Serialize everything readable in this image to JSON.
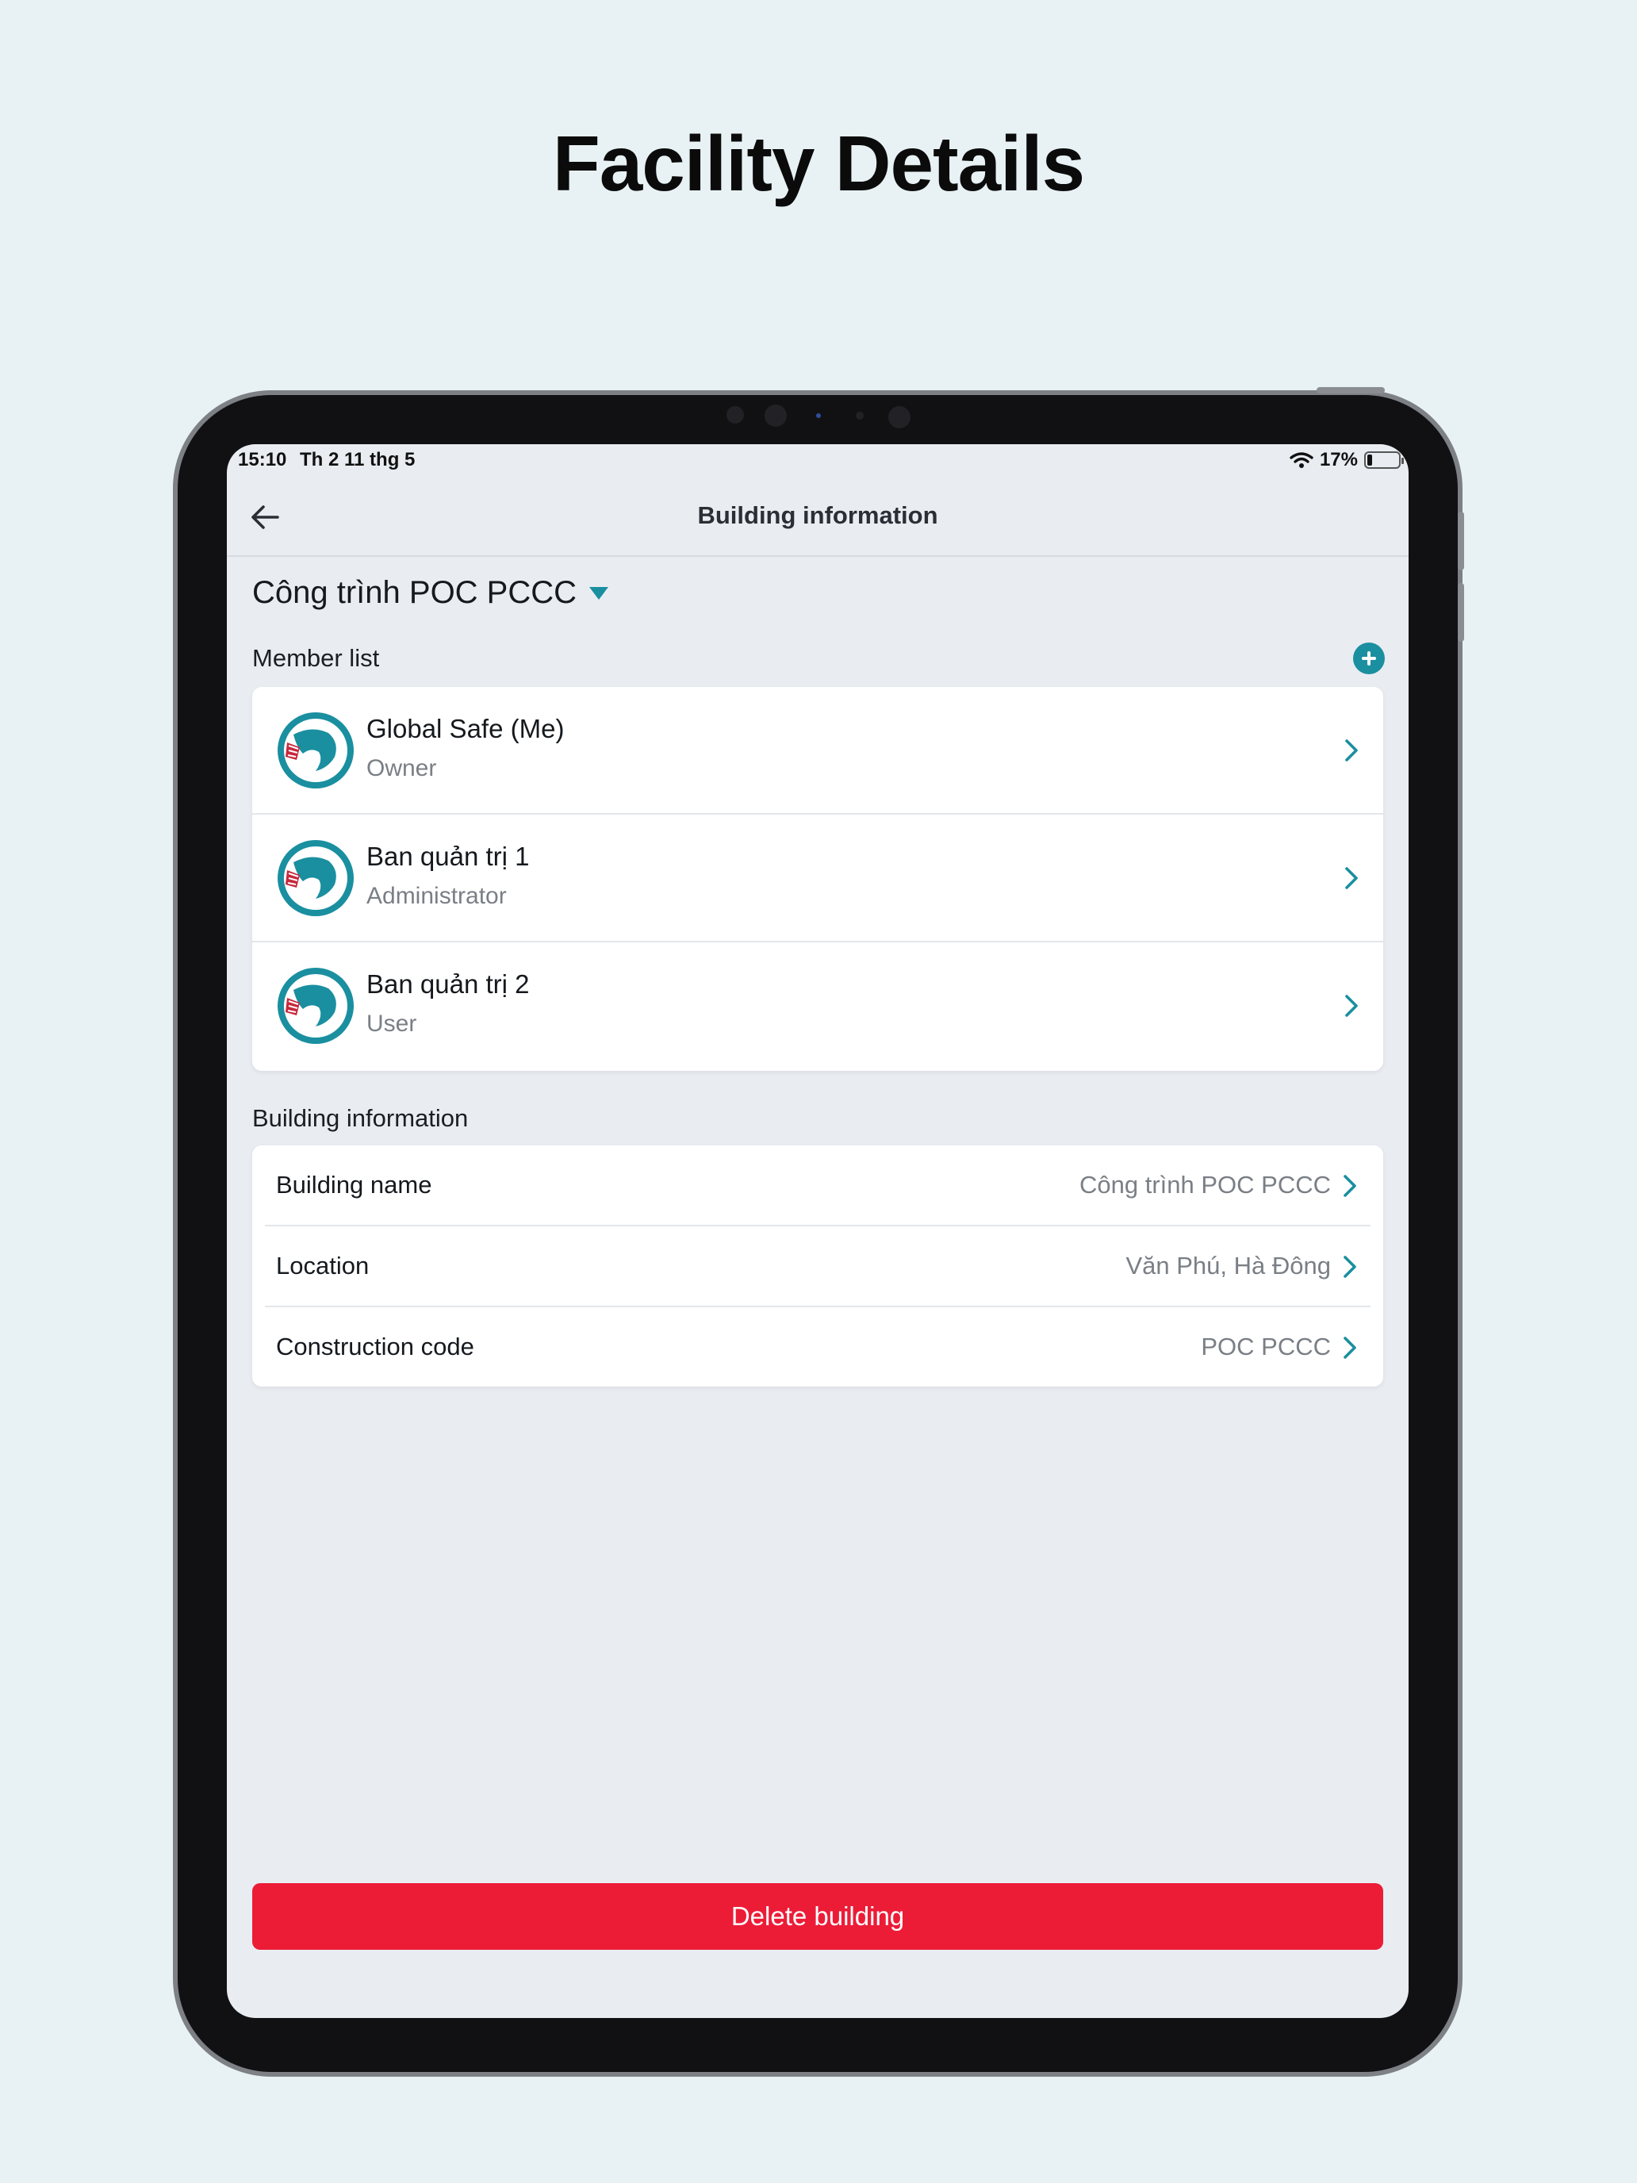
{
  "headline": "Facility Details",
  "status_bar": {
    "time": "15:10",
    "date": "Th 2 11 thg 5",
    "battery_percent": "17%",
    "battery_level": 0.17
  },
  "navbar": {
    "back_icon": "arrow-left-icon",
    "title": "Building information"
  },
  "building_selector": {
    "selected": "Công trình POC PCCC"
  },
  "members": {
    "section_title": "Member list",
    "add_icon": "plus-circle-icon",
    "items": [
      {
        "name": "Global Safe (Me)",
        "role": "Owner"
      },
      {
        "name": "Ban quản trị 1",
        "role": "Administrator"
      },
      {
        "name": "Ban quản trị 2",
        "role": "User"
      }
    ]
  },
  "building_info": {
    "section_title": "Building information",
    "rows": [
      {
        "label": "Building name",
        "value": "Công trình POC PCCC"
      },
      {
        "label": "Location",
        "value": "Văn Phú, Hà Đông"
      },
      {
        "label": "Construction code",
        "value": "POC PCCC"
      }
    ]
  },
  "actions": {
    "delete_label": "Delete building"
  },
  "colors": {
    "accent": "#1a8fa0",
    "danger": "#ec1c37",
    "page_background": "#e8f2f5",
    "screen_background": "#e9edf2"
  }
}
